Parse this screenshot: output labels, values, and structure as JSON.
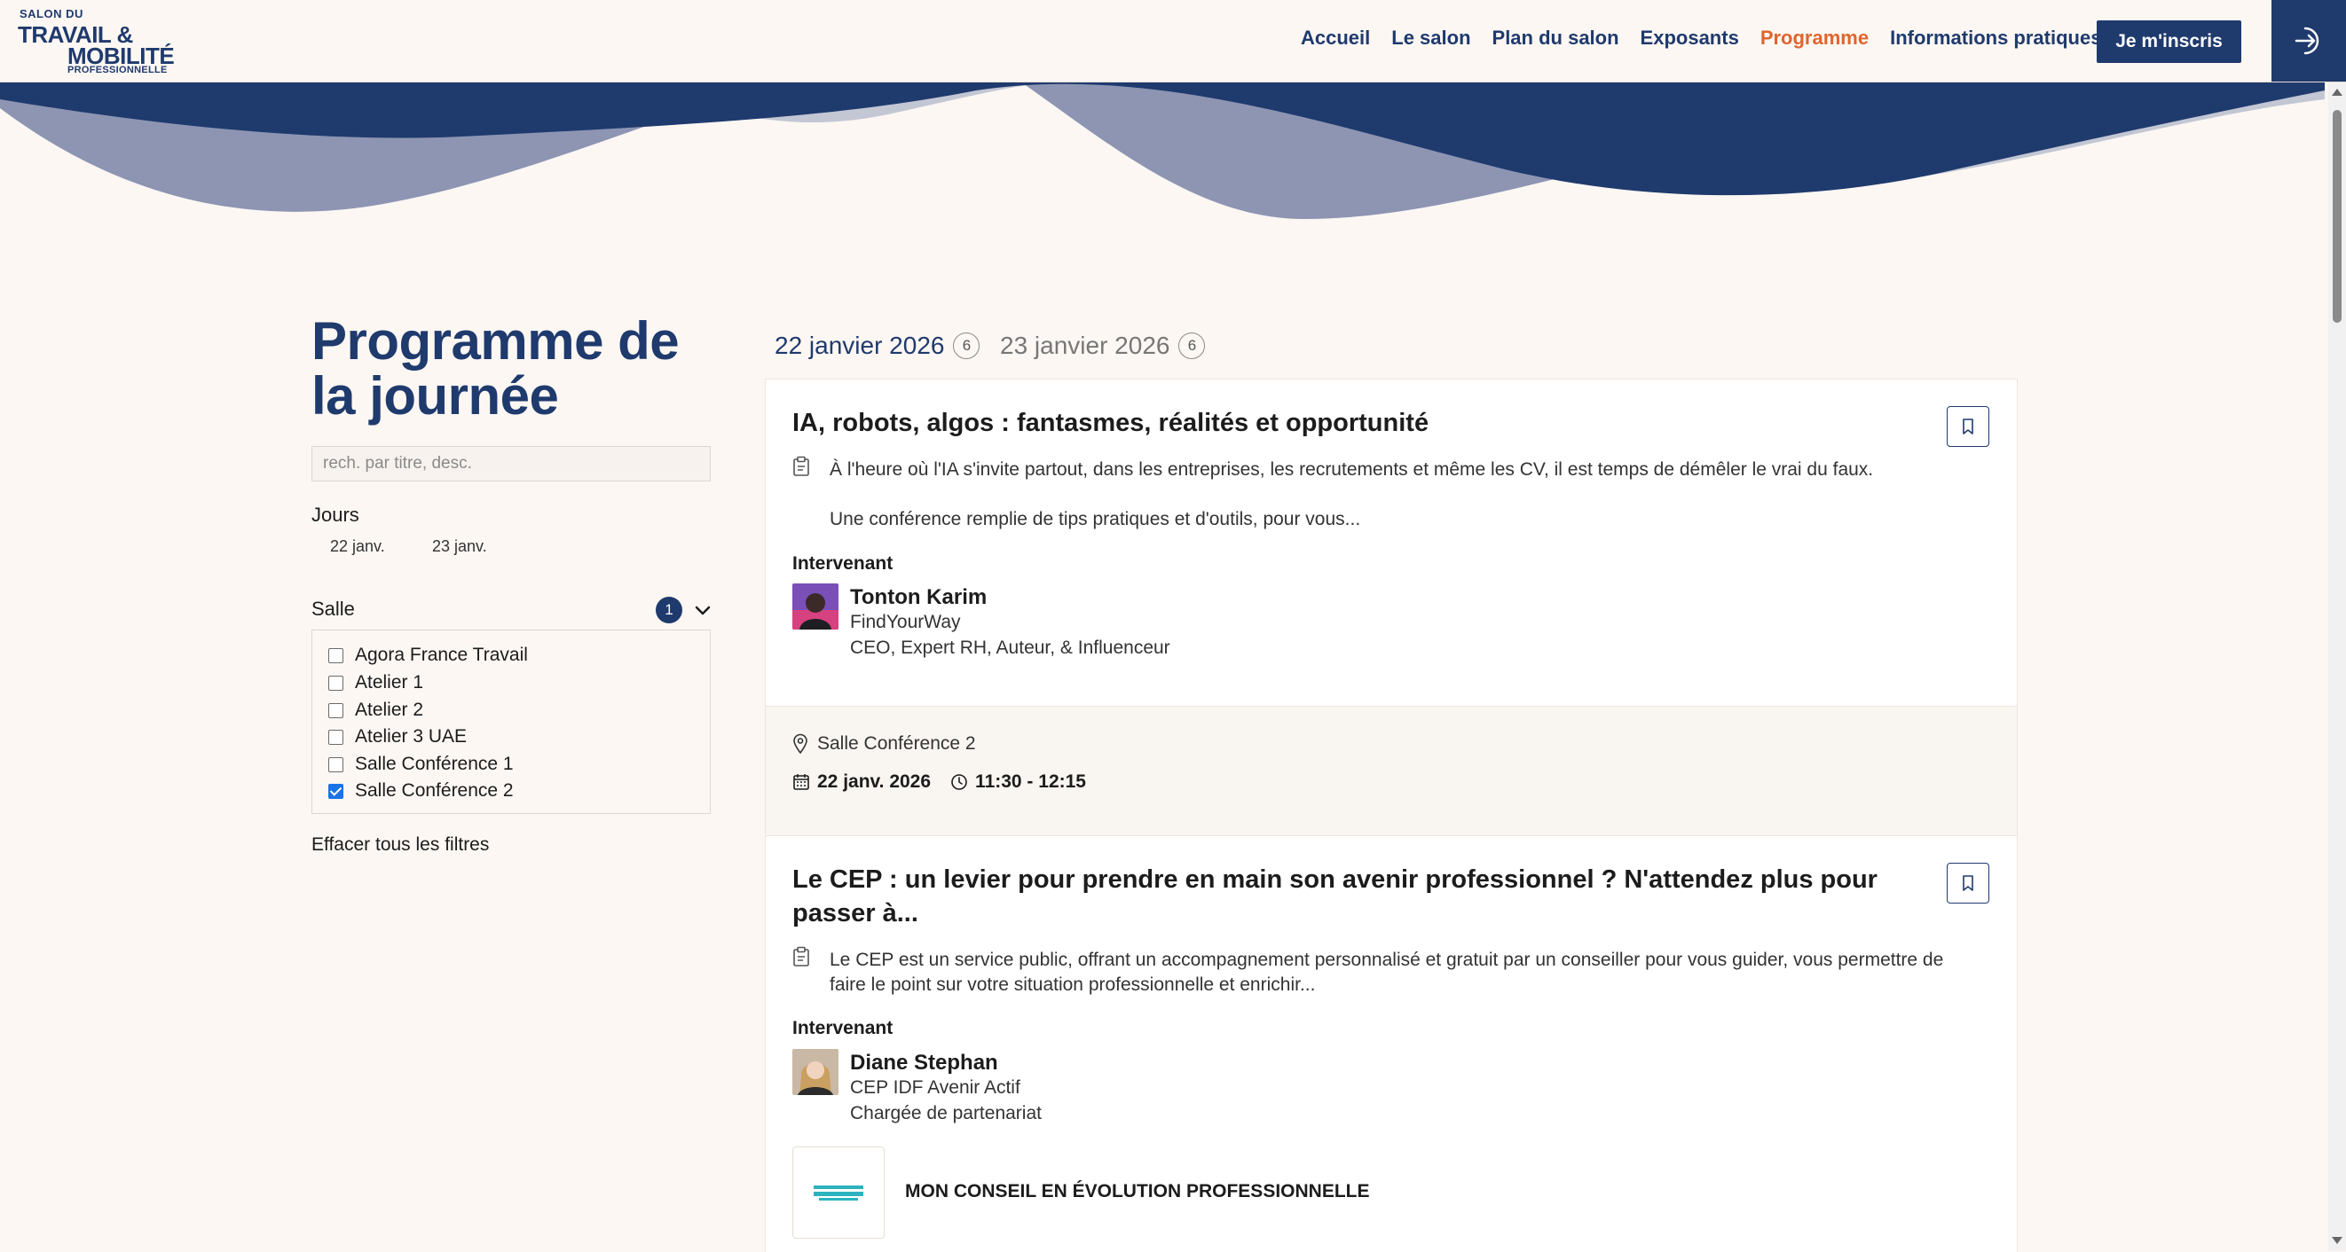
{
  "header": {
    "logo": {
      "line1": "SALON DU",
      "line2": "TRAVAIL &",
      "line3": "MOBILITÉ",
      "line4": "PROFESSIONNELLE"
    },
    "nav": [
      "Accueil",
      "Le salon",
      "Plan du salon",
      "Exposants",
      "Programme",
      "Informations pratiques"
    ],
    "nav_active": "Programme",
    "cta_label": "Je m'inscris",
    "login_icon": "login-icon"
  },
  "colors": {
    "brand": "#1f3a6d",
    "accent": "#e0652d",
    "background": "#fcf7f3"
  },
  "sidebar": {
    "title": "Programme de la journée",
    "search": {
      "placeholder": "rech. par titre, desc.",
      "value": ""
    },
    "days_label": "Jours",
    "days": [
      "22 janv.",
      "23 janv."
    ],
    "salle_label": "Salle",
    "salle_count": "1",
    "salles": [
      {
        "label": "Agora France Travail",
        "checked": false
      },
      {
        "label": "Atelier 1",
        "checked": false
      },
      {
        "label": "Atelier 2",
        "checked": false
      },
      {
        "label": "Atelier 3 UAE",
        "checked": false
      },
      {
        "label": "Salle Conférence 1",
        "checked": false
      },
      {
        "label": "Salle Conférence 2",
        "checked": true
      }
    ],
    "clear_filters": "Effacer tous les filtres"
  },
  "tabs": [
    {
      "label": "22 janvier 2026",
      "count": "6",
      "active": true
    },
    {
      "label": "23 janvier 2026",
      "count": "6",
      "active": false
    }
  ],
  "events": [
    {
      "title": "IA, robots, algos : fantasmes, réalités et opportunité",
      "desc_line1": "À l'heure où l'IA s'invite partout, dans les entreprises, les recrutements et même les CV, il est temps de démêler le vrai du faux.",
      "desc_line2": "Une conférence remplie de tips pratiques et d'outils, pour vous...",
      "speaker_label": "Intervenant",
      "speaker_name": "Tonton Karim",
      "speaker_company": "FindYourWay",
      "speaker_role": "CEO, Expert RH, Auteur, & Influenceur",
      "location": "Salle Conférence 2",
      "date": "22 janv. 2026",
      "time": "11:30 - 12:15"
    },
    {
      "title": "Le CEP : un levier pour prendre en main son avenir professionnel ? N'attendez plus pour passer à...",
      "desc_line1": "Le CEP est un service public, offrant un accompagnement personnalisé et gratuit par un conseiller pour vous guider, vous permettre de faire le point sur votre situation professionnelle et enrichir...",
      "speaker_label": "Intervenant",
      "speaker_name": "Diane Stephan",
      "speaker_company": "CEP IDF Avenir Actif",
      "speaker_role": "Chargée de partenariat",
      "partner_name": "MON CONSEIL EN ÉVOLUTION PROFESSIONNELLE"
    }
  ]
}
